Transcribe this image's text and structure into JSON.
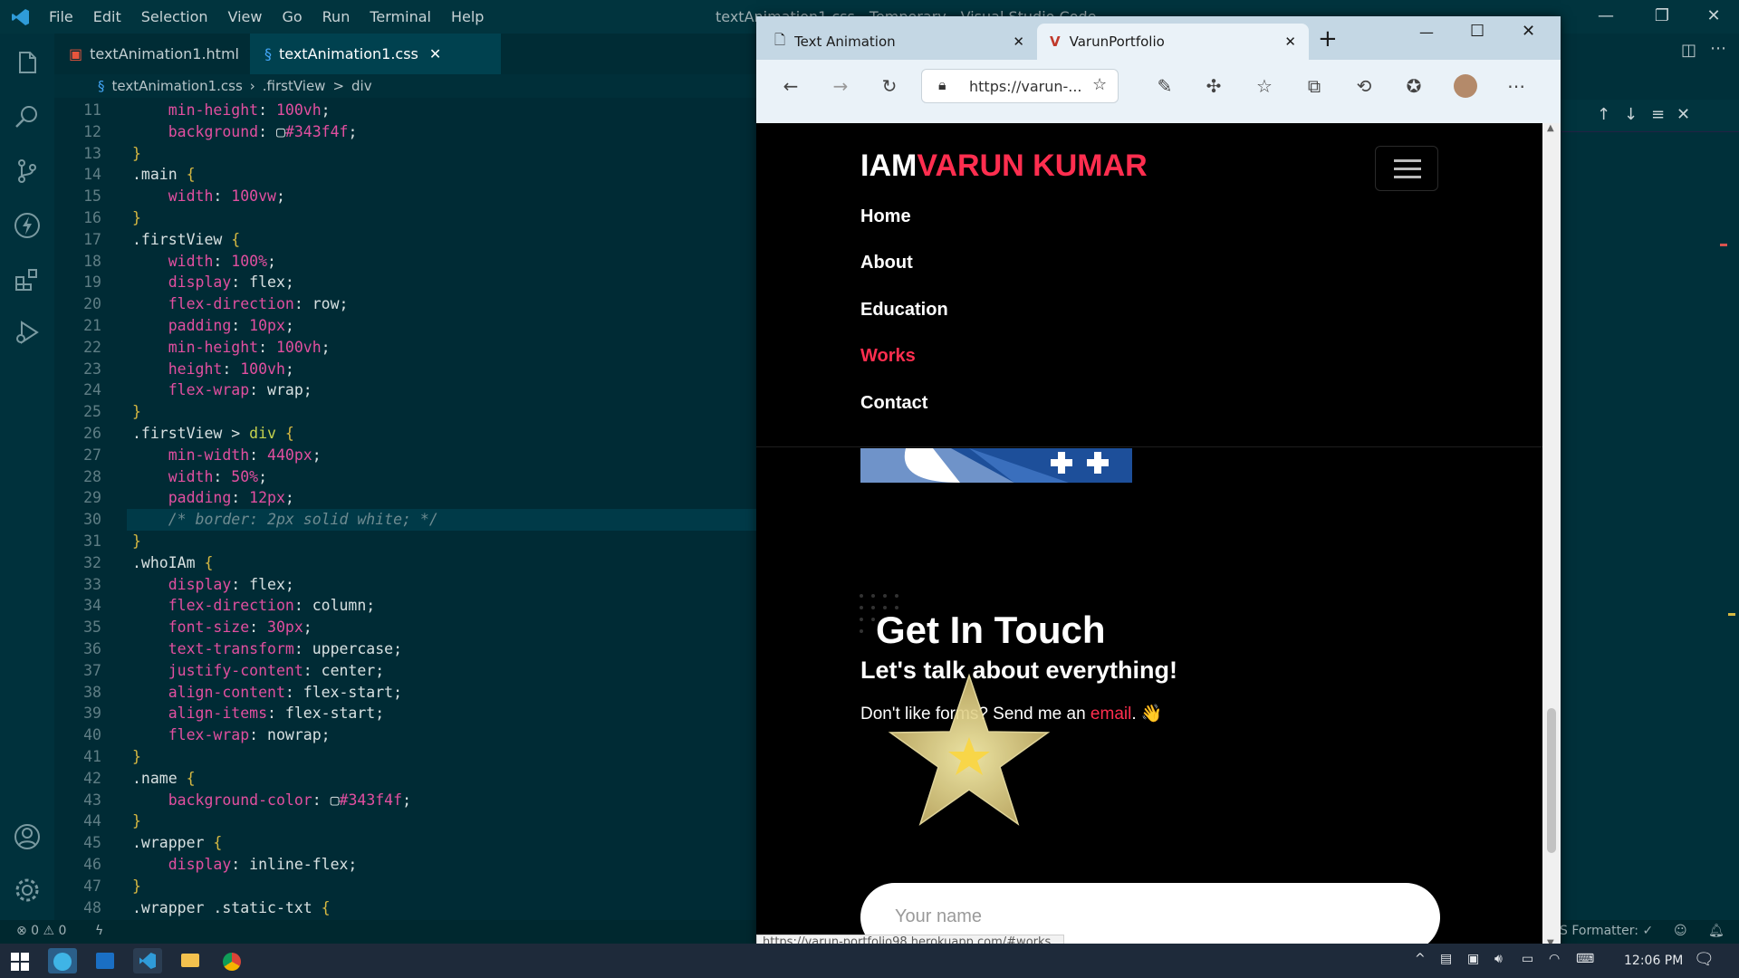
{
  "vscode": {
    "menu": [
      "File",
      "Edit",
      "Selection",
      "View",
      "Go",
      "Run",
      "Terminal",
      "Help"
    ],
    "window_title": "textAnimation1.css - Temporary - Visual Studio Code",
    "tabs": [
      {
        "label": "textAnimation1.html"
      },
      {
        "label": "textAnimation1.css",
        "close": "✕"
      }
    ],
    "breadcrumb": [
      "textAnimation1.css",
      "›",
      ".firstView",
      ">",
      "div"
    ],
    "code_lines": [
      {
        "n": "11",
        "html": "    <span class='pr'>min-height</span>: <span class='num'>100</span><span class='pr'>vh</span>;"
      },
      {
        "n": "12",
        "html": "    <span class='pr'>background</span>: ▢<span class='num'>#343f4f</span>;"
      },
      {
        "n": "13",
        "html": "<span class='sel'>}</span>"
      },
      {
        "n": "14",
        "html": "<span class='val'>.main</span> <span class='sel'>{</span>"
      },
      {
        "n": "15",
        "html": "    <span class='pr'>width</span>: <span class='num'>100</span><span class='pr'>vw</span>;"
      },
      {
        "n": "16",
        "html": "<span class='sel'>}</span>"
      },
      {
        "n": "17",
        "html": "<span class='val'>.firstView</span> <span class='sel'>{</span>"
      },
      {
        "n": "18",
        "html": "    <span class='pr'>width</span>: <span class='num'>100</span><span class='pr'>%</span>;"
      },
      {
        "n": "19",
        "html": "    <span class='pr'>display</span>: flex;"
      },
      {
        "n": "20",
        "html": "    <span class='pr'>flex-direction</span>: row;"
      },
      {
        "n": "21",
        "html": "    <span class='pr'>padding</span>: <span class='num'>10</span><span class='pr'>px</span>;"
      },
      {
        "n": "22",
        "html": "    <span class='pr'>min-height</span>: <span class='num'>100</span><span class='pr'>vh</span>;"
      },
      {
        "n": "23",
        "html": "    <span class='pr'>height</span>: <span class='num'>100</span><span class='pr'>vh</span>;"
      },
      {
        "n": "24",
        "html": "    <span class='pr'>flex-wrap</span>: wrap;"
      },
      {
        "n": "25",
        "html": "<span class='sel'>}</span>"
      },
      {
        "n": "26",
        "html": "<span class='val'>.firstView</span> &gt; <span class='kw'>div</span> <span class='sel'>{</span>"
      },
      {
        "n": "27",
        "html": "    <span class='pr'>min-width</span>: <span class='num'>440</span><span class='pr'>px</span>;"
      },
      {
        "n": "28",
        "html": "    <span class='pr'>width</span>: <span class='num'>50</span><span class='pr'>%</span>;"
      },
      {
        "n": "29",
        "html": "    <span class='pr'>padding</span>: <span class='num'>12</span><span class='pr'>px</span>;"
      },
      {
        "n": "30",
        "html": "    <span class='cm'>/* border: 2px solid white; */</span>"
      },
      {
        "n": "31",
        "html": "<span class='sel'>}</span>"
      },
      {
        "n": "32",
        "html": "<span class='val'>.whoIAm</span> <span class='sel'>{</span>"
      },
      {
        "n": "33",
        "html": "    <span class='pr'>display</span>: flex;"
      },
      {
        "n": "34",
        "html": "    <span class='pr'>flex-direction</span>: column;"
      },
      {
        "n": "35",
        "html": "    <span class='pr'>font-size</span>: <span class='num'>30</span><span class='pr'>px</span>;"
      },
      {
        "n": "36",
        "html": "    <span class='pr'>text-transform</span>: uppercase;"
      },
      {
        "n": "37",
        "html": "    <span class='pr'>justify-content</span>: center;"
      },
      {
        "n": "38",
        "html": "    <span class='pr'>align-content</span>: flex-start;"
      },
      {
        "n": "39",
        "html": "    <span class='pr'>align-items</span>: flex-start;"
      },
      {
        "n": "40",
        "html": "    <span class='pr'>flex-wrap</span>: nowrap;"
      },
      {
        "n": "41",
        "html": "<span class='sel'>}</span>"
      },
      {
        "n": "42",
        "html": "<span class='val'>.name</span> <span class='sel'>{</span>"
      },
      {
        "n": "43",
        "html": "    <span class='pr'>background-color</span>: ▢<span class='num'>#343f4f</span>;"
      },
      {
        "n": "44",
        "html": "<span class='sel'>}</span>"
      },
      {
        "n": "45",
        "html": "<span class='val'>.wrapper</span> <span class='sel'>{</span>"
      },
      {
        "n": "46",
        "html": "    <span class='pr'>display</span>: inline-flex;"
      },
      {
        "n": "47",
        "html": "<span class='sel'>}</span>"
      },
      {
        "n": "48",
        "html": "<span class='val'>.wrapper .static-txt</span> <span class='sel'>{</span>"
      }
    ],
    "status": {
      "problems": "⊗ 0  ⚠ 0",
      "formatter": "S Formatter: ✓"
    }
  },
  "browser": {
    "tabs": [
      {
        "label": "Text Animation",
        "close": "✕"
      },
      {
        "label": "VarunPortfolio",
        "close": "✕"
      }
    ],
    "new_tab": "+",
    "address": "https://varun-...",
    "status_url": "https://varun-portfolio98.herokuapp.com/#works",
    "site": {
      "brand_a": "IAM",
      "brand_b": "VARUN KUMAR",
      "nav": [
        "Home",
        "About",
        "Education",
        "Works",
        "Contact"
      ],
      "heading": "Get In Touch",
      "subheading": "Let's talk about everything!",
      "blurb_a": "Don't like forms? Send me an",
      "blurb_link": "email",
      "blurb_b": ". 👋",
      "name_placeholder": "Your name"
    },
    "colors": {
      "accent": "#ff2e4f",
      "page_bg": "#000000"
    }
  },
  "taskbar": {
    "time": "12:06 PM"
  }
}
